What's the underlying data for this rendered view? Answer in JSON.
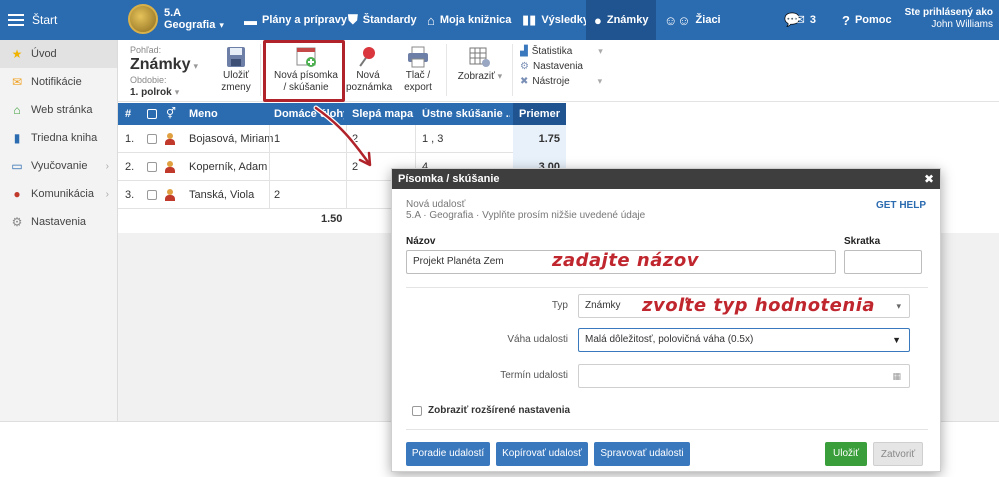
{
  "topbar": {
    "start_label": "Štart",
    "class_name": "5.A",
    "class_subject": "Geografia",
    "nav": [
      {
        "label": "Plány a prípravy",
        "icon": "briefcase-icon"
      },
      {
        "label": "Štandardy",
        "icon": "shield-icon"
      },
      {
        "label": "Moja knižnica",
        "icon": "library-icon"
      },
      {
        "label": "Výsledky",
        "icon": "bar-chart-icon"
      },
      {
        "label": "Známky",
        "icon": "grades-icon"
      },
      {
        "label": "Žiaci",
        "icon": "students-icon"
      }
    ],
    "messages_count": "3",
    "help_label": "Pomoc",
    "user_line1": "Ste prihlásený ako",
    "user_line2": "John Williams",
    "colors": {
      "bar": "#2b6bb0",
      "active": "#1f5491"
    }
  },
  "sidebar": {
    "items": [
      {
        "label": "Úvod",
        "icon": "star-icon"
      },
      {
        "label": "Notifikácie",
        "icon": "envelope-icon"
      },
      {
        "label": "Web stránka",
        "icon": "home-icon"
      },
      {
        "label": "Triedna kniha",
        "icon": "book-icon"
      },
      {
        "label": "Vyučovanie",
        "icon": "teaching-icon"
      },
      {
        "label": "Komunikácia",
        "icon": "chat-icon"
      },
      {
        "label": "Nastavenia",
        "icon": "gear-icon"
      }
    ]
  },
  "toolbar": {
    "view_label": "Pohľad:",
    "view_value": "Známky",
    "period_label": "Obdobie:",
    "period_value": "1. polrok",
    "save_l1": "Uložiť",
    "save_l2": "zmeny",
    "new_l1": "Nová písomka",
    "new_l2": "/ skúšanie",
    "note_l1": "Nová",
    "note_l2": "poznámka",
    "print_l1": "Tlač /",
    "print_l2": "export",
    "show_label": "Zobraziť",
    "stats_label": "Štatistika",
    "settings_label": "Nastavenia",
    "tools_label": "Nástroje"
  },
  "grid": {
    "headers": {
      "num": "#",
      "name": "Meno",
      "homework": "Domáce úlohy",
      "blind_map": "Slepá mapa",
      "oral": "Ústne skúšanie ...",
      "average": "Priemer"
    },
    "rows": [
      {
        "num": "1.",
        "name": "Bojasová, Miriam",
        "homework": "1",
        "blind_map": "2",
        "oral": "1 , 3",
        "average": "1.75"
      },
      {
        "num": "2.",
        "name": "Koperník, Adam",
        "homework": "",
        "blind_map": "2",
        "oral": "4",
        "average": "3.00"
      },
      {
        "num": "3.",
        "name": "Tanská, Viola",
        "homework": "2",
        "blind_map": "",
        "oral": "",
        "average": ""
      }
    ],
    "footer_avg": "1.50"
  },
  "modal": {
    "title": "Písomka / skúšanie",
    "sub1": "Nová udalosť",
    "sub2": "5.A · Geografia · Vyplňte prosím nižšie uvedené údaje",
    "get_help": "GET HELP",
    "name_label": "Názov",
    "name_value": "Projekt Planéta Zem",
    "abbr_label": "Skratka",
    "abbr_value": "",
    "type_label": "Typ",
    "type_value": "Známky",
    "weight_label": "Váha udalosti",
    "weight_value": "Malá dôležitosť, polovičná váha (0.5x)",
    "date_label": "Termín udalosti",
    "date_value": "",
    "advanced_label": "Zobraziť rozšírené nastavenia",
    "btn_order": "Poradie udalostí",
    "btn_copy": "Kopírovať udalosť",
    "btn_manage": "Spravovať udalosti",
    "btn_save": "Uložiť",
    "btn_close": "Zatvoriť"
  },
  "annotations": {
    "name_hint": "zadajte názov",
    "type_hint": "zvoľte typ hodnotenia",
    "color": "#c0262e"
  }
}
